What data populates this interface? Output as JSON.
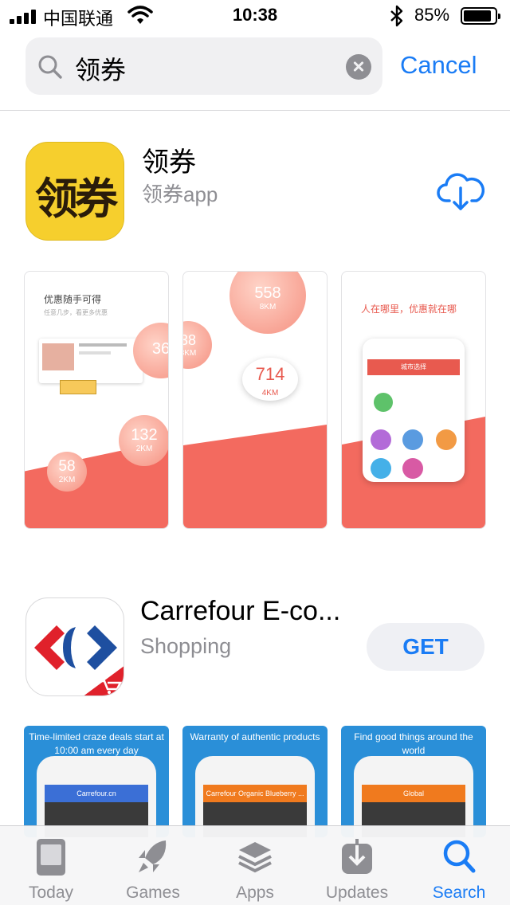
{
  "status_bar": {
    "carrier": "中国联通",
    "time": "10:38",
    "battery_pct": "85%",
    "battery_level": 0.85
  },
  "search": {
    "query": "领券",
    "cancel_label": "Cancel"
  },
  "results": [
    {
      "name": "领券",
      "subtitle": "领券app",
      "icon_text": "领券",
      "icon_color": "#f6cf2d",
      "screenshots": [
        {
          "title": "优惠随手可得",
          "subtitle": "任意几步，看更多优惠",
          "bubbles": [
            {
              "value": "58",
              "unit": "2KM"
            },
            {
              "value": "132",
              "unit": "2KM"
            },
            {
              "value": "36",
              "unit": ""
            }
          ]
        },
        {
          "bubbles": [
            {
              "value": "558",
              "unit": "8KM"
            },
            {
              "value": "714",
              "unit": "4KM"
            },
            {
              "value": "38",
              "unit": "3KM"
            }
          ]
        },
        {
          "title": "人在哪里，优惠就在哪",
          "panel_title": "城市选择"
        }
      ]
    },
    {
      "name": "Carrefour E-co...",
      "category": "Shopping",
      "action_label": "GET",
      "screenshots": [
        {
          "caption": "Time-limited craze deals start at 10:00 am every day",
          "bar_text": "Carrefour.cn"
        },
        {
          "caption": "Warranty of authentic products",
          "bar_text": "Carrefour Organic Blueberry ..."
        },
        {
          "caption": "Find good things around the world",
          "bar_text": "Global"
        }
      ]
    }
  ],
  "tab_bar": {
    "tabs": [
      {
        "label": "Today",
        "icon": "today-icon"
      },
      {
        "label": "Games",
        "icon": "rocket-icon"
      },
      {
        "label": "Apps",
        "icon": "layers-icon"
      },
      {
        "label": "Updates",
        "icon": "download-icon"
      },
      {
        "label": "Search",
        "icon": "search-icon",
        "active": true
      }
    ]
  },
  "colors": {
    "accent": "#1a7cf5",
    "coral": "#f36a5f",
    "carrefour_blue": "#2a8fd8"
  }
}
